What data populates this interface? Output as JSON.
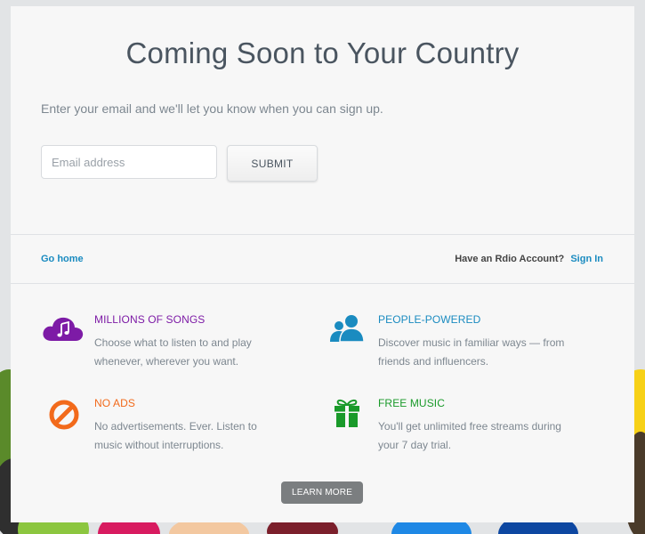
{
  "heading": "Coming Soon to Your Country",
  "subheading": "Enter your email and we'll let you know when you can sign up.",
  "signup": {
    "email_placeholder": "Email address",
    "email_value": "",
    "submit_label": "SUBMIT"
  },
  "nav": {
    "go_home": "Go home",
    "account_prompt": "Have an Rdio Account?",
    "sign_in": "Sign In"
  },
  "features": [
    {
      "icon": "music-cloud-icon",
      "title": "MILLIONS OF SONGS",
      "description": "Choose what to listen to and play whenever, wherever you want.",
      "color": "#7d1ba6"
    },
    {
      "icon": "people-icon",
      "title": "PEOPLE-POWERED",
      "description": "Discover music in familiar ways — from friends and influencers.",
      "color": "#1a8bc0"
    },
    {
      "icon": "no-ads-icon",
      "title": "NO ADS",
      "description": "No advertisements. Ever. Listen to music without interruptions.",
      "color": "#f26a1b"
    },
    {
      "icon": "gift-icon",
      "title": "FREE MUSIC",
      "description": "You'll get unlimited free streams during your 7 day trial.",
      "color": "#1a9a2a"
    }
  ],
  "learn_more": "LEARN MORE",
  "colors": {
    "accent_link": "#1a8bc0",
    "purple": "#7d1ba6",
    "orange": "#f26a1b",
    "green": "#1a9a2a",
    "button_dark": "#7b7e80"
  }
}
